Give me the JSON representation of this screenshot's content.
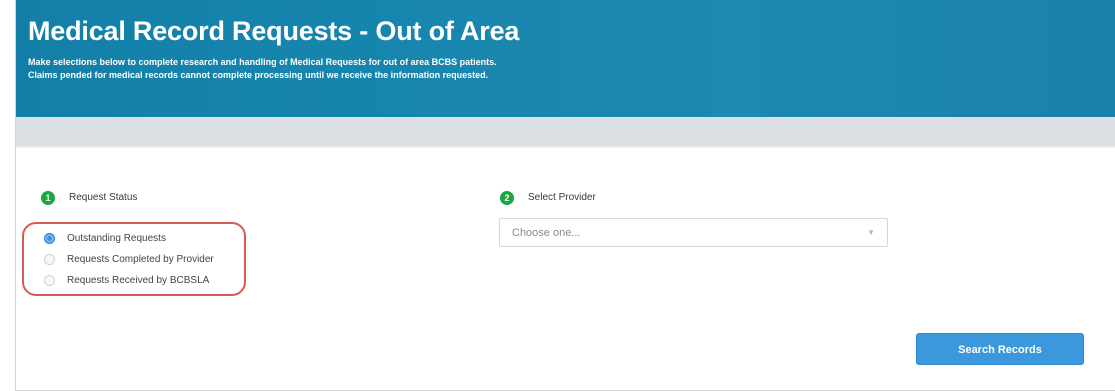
{
  "header": {
    "title": "Medical Record Requests - Out of Area",
    "description_line_1": "Make selections below to complete research and handling of Medical Requests for out of area BCBS patients.",
    "description_line_2": "Claims pended for medical records cannot complete processing until we receive the information requested."
  },
  "steps": [
    {
      "number": "1",
      "label": "Request Status"
    },
    {
      "number": "2",
      "label": "Select Provider"
    }
  ],
  "request_status": {
    "options": [
      {
        "label": "Outstanding Requests",
        "selected": true
      },
      {
        "label": "Requests Completed by Provider",
        "selected": false
      },
      {
        "label": "Requests Received by BCBSLA",
        "selected": false
      }
    ]
  },
  "provider": {
    "selected_value": "Choose one..."
  },
  "actions": {
    "search_label": "Search Records"
  },
  "colors": {
    "header": "#1685ad",
    "step_badge": "#19a83f",
    "selected_radio": "#3f8ee7",
    "highlight_outline": "#d95a4f",
    "search_button": "#3b98dd"
  },
  "icons": {
    "select_caret": "chevron-down-icon"
  }
}
